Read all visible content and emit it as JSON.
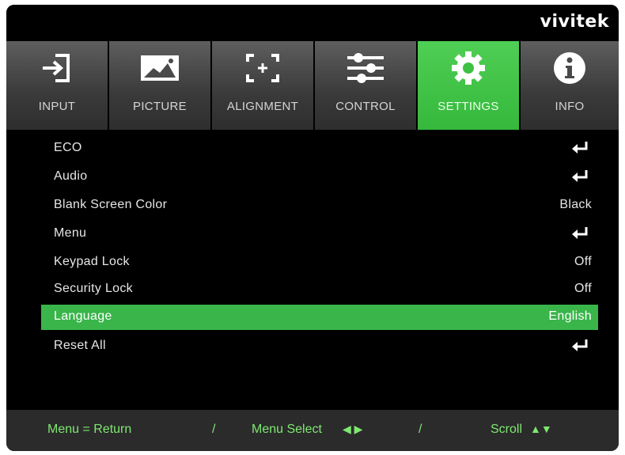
{
  "brand": "vivitek",
  "tabs": [
    {
      "label": "INPUT",
      "icon": "input-icon",
      "active": false
    },
    {
      "label": "PICTURE",
      "icon": "picture-icon",
      "active": false
    },
    {
      "label": "ALIGNMENT",
      "icon": "alignment-icon",
      "active": false
    },
    {
      "label": "CONTROL",
      "icon": "control-sliders-icon",
      "active": false
    },
    {
      "label": "SETTINGS",
      "icon": "gear-icon",
      "active": true
    },
    {
      "label": "INFO",
      "icon": "info-icon",
      "active": false
    }
  ],
  "menu": [
    {
      "label": "ECO",
      "value": "",
      "enter": true
    },
    {
      "label": "Audio",
      "value": "",
      "enter": true
    },
    {
      "label": "Blank Screen Color",
      "value": "Black",
      "enter": false
    },
    {
      "label": "Menu",
      "value": "",
      "enter": true
    },
    {
      "label": "Keypad Lock",
      "value": "Off",
      "enter": false
    },
    {
      "label": "Security Lock",
      "value": "Off",
      "enter": false
    },
    {
      "label": "Language",
      "value": "English",
      "enter": false,
      "selected": true
    },
    {
      "label": "Reset All",
      "value": "",
      "enter": true
    }
  ],
  "footer": {
    "return_hint": "Menu = Return",
    "sep1": "/",
    "select_hint": "Menu Select",
    "select_arrows": "◀ ▶",
    "sep2": "/",
    "scroll_hint": "Scroll",
    "scroll_arrows": "▲▼"
  },
  "colors": {
    "accent": "#39b54a",
    "footer_text": "#7ee870",
    "tab_bg": "#4a4a4a"
  }
}
